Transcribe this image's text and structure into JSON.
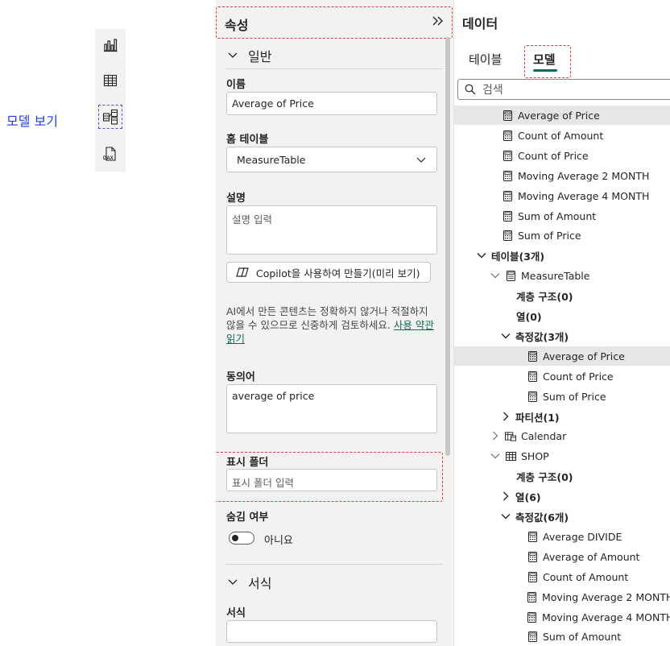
{
  "annotation": {
    "model_view_label": "모델 보기"
  },
  "rail": {
    "buttons": [
      {
        "name": "report-view-icon"
      },
      {
        "name": "table-view-icon"
      },
      {
        "name": "model-view-icon",
        "selected": true
      },
      {
        "name": "dax-query-view-icon",
        "text": "DAX"
      }
    ]
  },
  "properties": {
    "title": "속성",
    "general_section": "일반",
    "name_label": "이름",
    "name_value": "Average of Price",
    "home_table_label": "홈 테이블",
    "home_table_value": "MeasureTable",
    "description_label": "설명",
    "description_placeholder": "설명 입력",
    "copilot_button": "Copilot을 사용하여 만들기(미리 보기)",
    "ai_note": "AI에서 만든 콘텐츠는 정확하지 않거나 적절하지 않을 수 있으므로 신중하게 검토하세요.",
    "ai_link": "사용 약관 읽기",
    "synonyms_label": "동의어",
    "synonyms_value": "average of price",
    "display_folder_label": "표시 폴더",
    "display_folder_placeholder": "표시 폴더 입력",
    "hidden_label": "숨김 여부",
    "hidden_value": "아니요",
    "format_section": "서식",
    "format_label": "서식"
  },
  "data_pane": {
    "title": "데이터",
    "tabs": [
      "테이블",
      "모델"
    ],
    "active_tab": "모델",
    "search_placeholder": "검색",
    "tree": [
      {
        "label": "Average of Price",
        "icon": "calculator-icon",
        "indent": 0,
        "highlight": true
      },
      {
        "label": "Count of Amount",
        "icon": "calculator-icon",
        "indent": 0
      },
      {
        "label": "Count of Price",
        "icon": "calculator-icon",
        "indent": 0
      },
      {
        "label": "Moving Average 2 MONTH",
        "icon": "calculator-icon",
        "indent": 0
      },
      {
        "label": "Moving Average 4 MONTH",
        "icon": "calculator-icon",
        "indent": 0
      },
      {
        "label": "Sum of Amount",
        "icon": "calculator-icon",
        "indent": 0
      },
      {
        "label": "Sum of Price",
        "icon": "calculator-icon",
        "indent": 0
      },
      {
        "label": "테이블(3개)",
        "chevron": "down",
        "bold": true,
        "indent": -1
      },
      {
        "label": "MeasureTable",
        "chevron": "down-thin",
        "icon": "measure-table-icon",
        "indent": 0
      },
      {
        "label": "계층 구조(0)",
        "bold": true,
        "indent": 1
      },
      {
        "label": "열(0)",
        "bold": true,
        "indent": 1
      },
      {
        "label": "측정값(3개)",
        "chevron": "down",
        "bold": true,
        "indent": 1
      },
      {
        "label": "Average of Price",
        "icon": "calculator-icon",
        "indent": 2,
        "highlight": true
      },
      {
        "label": "Count of Price",
        "icon": "calculator-icon",
        "indent": 2
      },
      {
        "label": "Sum of Price",
        "icon": "calculator-icon",
        "indent": 2
      },
      {
        "label": "파티션(1)",
        "chevron": "right",
        "bold": true,
        "indent": 1
      },
      {
        "label": "Calendar",
        "chevron": "right-thin",
        "icon": "calendar-table-icon",
        "indent": 0
      },
      {
        "label": "SHOP",
        "chevron": "down-thin",
        "icon": "table-icon",
        "indent": 0
      },
      {
        "label": "계층 구조(0)",
        "bold": true,
        "indent": 1
      },
      {
        "label": "열(6)",
        "chevron": "right",
        "bold": true,
        "indent": 1
      },
      {
        "label": "측정값(6개)",
        "chevron": "down",
        "bold": true,
        "indent": 1
      },
      {
        "label": "Average DIVIDE",
        "icon": "calculator-icon",
        "indent": 2
      },
      {
        "label": "Average of Amount",
        "icon": "calculator-icon",
        "indent": 2
      },
      {
        "label": "Count of Amount",
        "icon": "calculator-icon",
        "indent": 2
      },
      {
        "label": "Moving Average 2 MONTH",
        "icon": "calculator-icon",
        "indent": 2
      },
      {
        "label": "Moving Average 4 MONTH",
        "icon": "calculator-icon",
        "indent": 2
      },
      {
        "label": "Sum of Amount",
        "icon": "calculator-icon",
        "indent": 2
      }
    ]
  },
  "colors": {
    "accent": "#0f6b5a",
    "annotation_red": "#e03a3a",
    "annotation_blue": "#4a55d6"
  }
}
